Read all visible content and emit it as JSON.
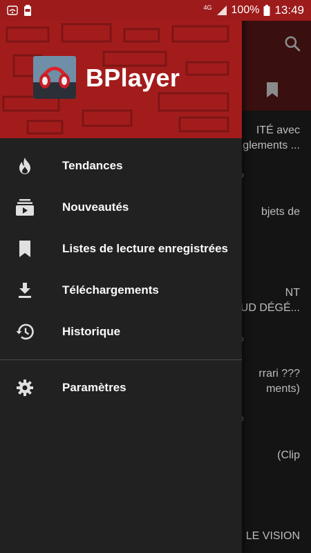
{
  "status_bar": {
    "network": "4G",
    "battery_percent": "100%",
    "time": "13:49"
  },
  "drawer": {
    "app_name": "BPlayer",
    "items": [
      {
        "label": "Tendances",
        "icon": "fire-icon"
      },
      {
        "label": "Nouveautés",
        "icon": "subscriptions-icon"
      },
      {
        "label": "Listes de lecture enregistrées",
        "icon": "bookmark-icon"
      },
      {
        "label": "Téléchargements",
        "icon": "download-icon"
      },
      {
        "label": "Historique",
        "icon": "history-icon"
      }
    ],
    "settings": {
      "label": "Paramètres",
      "icon": "gear-icon"
    }
  },
  "background": {
    "videos": [
      {
        "line1": "ITÉ avec",
        "line2": "glements ..."
      },
      {
        "line1": "bjets de",
        "line2": ""
      },
      {
        "line1": "NT",
        "line2": "UD DÉGÉ..."
      },
      {
        "line1": "rrari ???",
        "line2": "ments)"
      },
      {
        "line1": "(Clip",
        "line2": ""
      },
      {
        "line1": "LE VISION",
        "line2": ""
      }
    ]
  },
  "colors": {
    "accent": "#a31c1c",
    "drawer_bg": "#212121",
    "status_bar": "#9e1b1b"
  }
}
